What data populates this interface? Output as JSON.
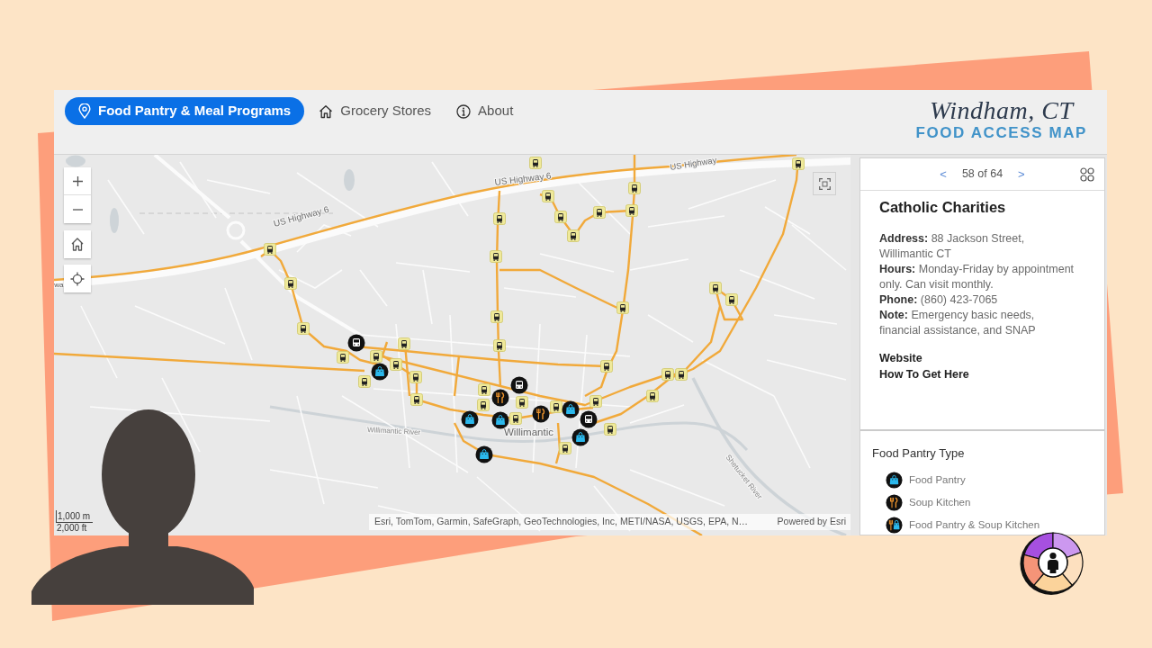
{
  "header": {
    "tabs": [
      {
        "label": "Food Pantry & Meal Programs",
        "selected": true
      },
      {
        "label": "Grocery Stores",
        "selected": false
      },
      {
        "label": "About",
        "selected": false
      }
    ],
    "title": "Windham, CT",
    "subtitle": "FOOD ACCESS MAP"
  },
  "map": {
    "labels": [
      "US Highway 6",
      "US Highway",
      "US Highway 6",
      "wa",
      "Willimantic River",
      "Willimantic",
      "Shetucket River"
    ],
    "scale": [
      "1,000 m",
      "2,000 ft"
    ],
    "attribution": "Esri, TomTom, Garmin, SafeGraph, GeoTechnologies, Inc, METI/NASA, USGS, EPA, N…",
    "credit": "Powered by Esri"
  },
  "panel": {
    "pager": {
      "previous": "<",
      "position": "58 of 64",
      "next": ">"
    },
    "title": "Catholic Charities",
    "details": [
      "**Address:** 88 Jackson Street, Willimantic CT",
      "**Hours:** Monday-Friday by appointment only. Can visit monthly.",
      "**Phone:** (860) 423-7065",
      "**Note:** Emergency basic needs, financial assistance, and SNAP"
    ],
    "links": [
      "Website",
      "How To Get Here"
    ]
  },
  "legend": {
    "title": "Food Pantry Type",
    "items": [
      {
        "label": "Food Pantry",
        "kind": "pantry"
      },
      {
        "label": "Soup Kitchen",
        "kind": "kitchen"
      },
      {
        "label": "Food Pantry & Soup Kitchen",
        "kind": "both"
      }
    ]
  }
}
